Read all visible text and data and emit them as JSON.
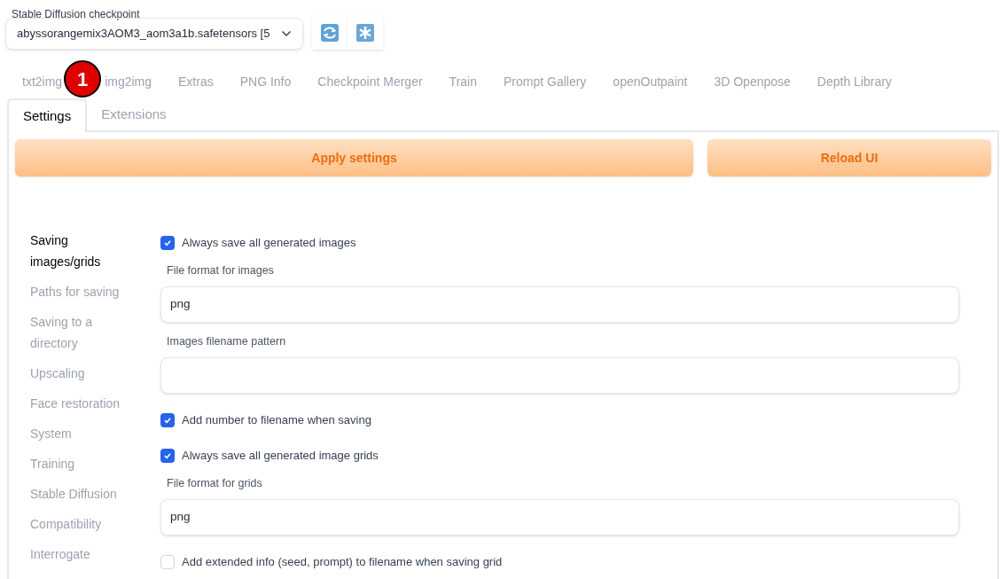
{
  "checkpoint": {
    "label": "Stable Diffusion checkpoint",
    "value": "abyssorangemix3AOM3_aom3a1b.safetensors [5"
  },
  "tabs_row_1": [
    {
      "label": "txt2img",
      "selected": false
    },
    {
      "label": "img2img",
      "selected": false
    },
    {
      "label": "Extras",
      "selected": false
    },
    {
      "label": "PNG Info",
      "selected": false
    },
    {
      "label": "Checkpoint Merger",
      "selected": false
    },
    {
      "label": "Train",
      "selected": false
    },
    {
      "label": "Prompt Gallery",
      "selected": false
    },
    {
      "label": "openOutpaint",
      "selected": false
    },
    {
      "label": "3D Openpose",
      "selected": false
    },
    {
      "label": "Depth Library",
      "selected": false
    }
  ],
  "tabs_row_2": [
    {
      "label": "Settings",
      "selected": true
    },
    {
      "label": "Extensions",
      "selected": false
    }
  ],
  "step_badge": "1",
  "buttons": [
    "Apply settings",
    "Reload UI"
  ],
  "sidebar": [
    {
      "label": "Saving images/grids",
      "selected": true
    },
    {
      "label": "Paths for saving",
      "selected": false
    },
    {
      "label": "Saving to a directory",
      "selected": false
    },
    {
      "label": "Upscaling",
      "selected": false
    },
    {
      "label": "Face restoration",
      "selected": false
    },
    {
      "label": "System",
      "selected": false
    },
    {
      "label": "Training",
      "selected": false
    },
    {
      "label": "Stable Diffusion",
      "selected": false
    },
    {
      "label": "Compatibility",
      "selected": false
    },
    {
      "label": "Interrogate",
      "selected": false
    }
  ],
  "settings": [
    {
      "kind": "checkbox",
      "label": "Always save all generated images",
      "checked": true
    },
    {
      "kind": "field",
      "label": "File format for images",
      "value": "png"
    },
    {
      "kind": "field",
      "label": "Images filename pattern"
    },
    {
      "kind": "checkbox",
      "label": "Add number to filename when saving",
      "checked": true
    },
    {
      "kind": "checkbox",
      "label": "Always save all generated image grids",
      "checked": true
    },
    {
      "kind": "field",
      "label": "File format for grids",
      "value": "png"
    },
    {
      "kind": "checkbox",
      "label": "Add extended info (seed, prompt) to filename when saving grid",
      "checked": false
    }
  ]
}
